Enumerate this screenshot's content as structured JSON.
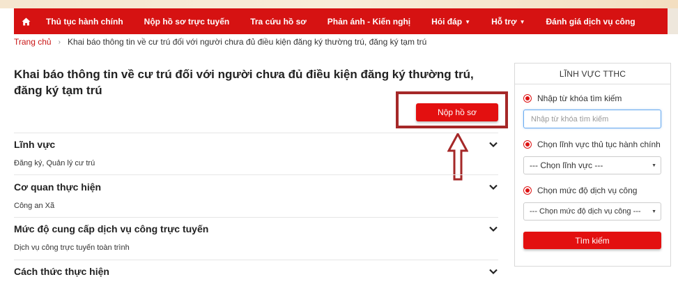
{
  "nav": {
    "items": [
      {
        "label": "Thủ tục hành chính",
        "dropdown": false
      },
      {
        "label": "Nộp hồ sơ trực tuyến",
        "dropdown": false
      },
      {
        "label": "Tra cứu hồ sơ",
        "dropdown": false
      },
      {
        "label": "Phản ánh - Kiến nghị",
        "dropdown": false
      },
      {
        "label": "Hỏi đáp",
        "dropdown": true
      },
      {
        "label": "Hỗ trợ",
        "dropdown": true
      },
      {
        "label": "Đánh giá dịch vụ công",
        "dropdown": false
      }
    ]
  },
  "breadcrumb": {
    "home": "Trang chủ",
    "current": "Khai báo thông tin về cư trú đối với người chưa đủ điều kiện đăng ký thường trú, đăng ký tạm trú"
  },
  "page": {
    "title": "Khai báo thông tin về cư trú đối với người chưa đủ điều kiện đăng ký thường trú, đăng ký tạm trú",
    "submit_label": "Nộp hồ sơ"
  },
  "sections": [
    {
      "title": "Lĩnh vực",
      "value": "Đăng ký, Quản lý cư trú"
    },
    {
      "title": "Cơ quan thực hiện",
      "value": "Công an Xã"
    },
    {
      "title": "Mức độ cung cấp dịch vụ công trực tuyến",
      "value": "Dịch vụ công trực tuyến toàn trình"
    },
    {
      "title": "Cách thức thực hiện",
      "value": ""
    }
  ],
  "sidebar": {
    "header": "LĨNH VỰC TTHC",
    "keyword_label": "Nhập từ khóa tìm kiếm",
    "keyword_placeholder": "Nhập từ khóa tìm kiếm",
    "field_label": "Chọn lĩnh vực thủ tục hành chính",
    "field_selected": "--- Chọn lĩnh vực ---",
    "level_label": "Chọn mức độ dịch vụ công",
    "level_selected": "--- Chọn mức độ dịch vụ công ---",
    "search_label": "Tìm kiếm"
  },
  "colors": {
    "brand_red": "#d61212",
    "button_red": "#e31010",
    "highlight_border": "#a52828"
  },
  "icons": {
    "home": "home-icon",
    "section_toggle": "chevron-down-icon",
    "annotation": "up-arrow-icon"
  }
}
